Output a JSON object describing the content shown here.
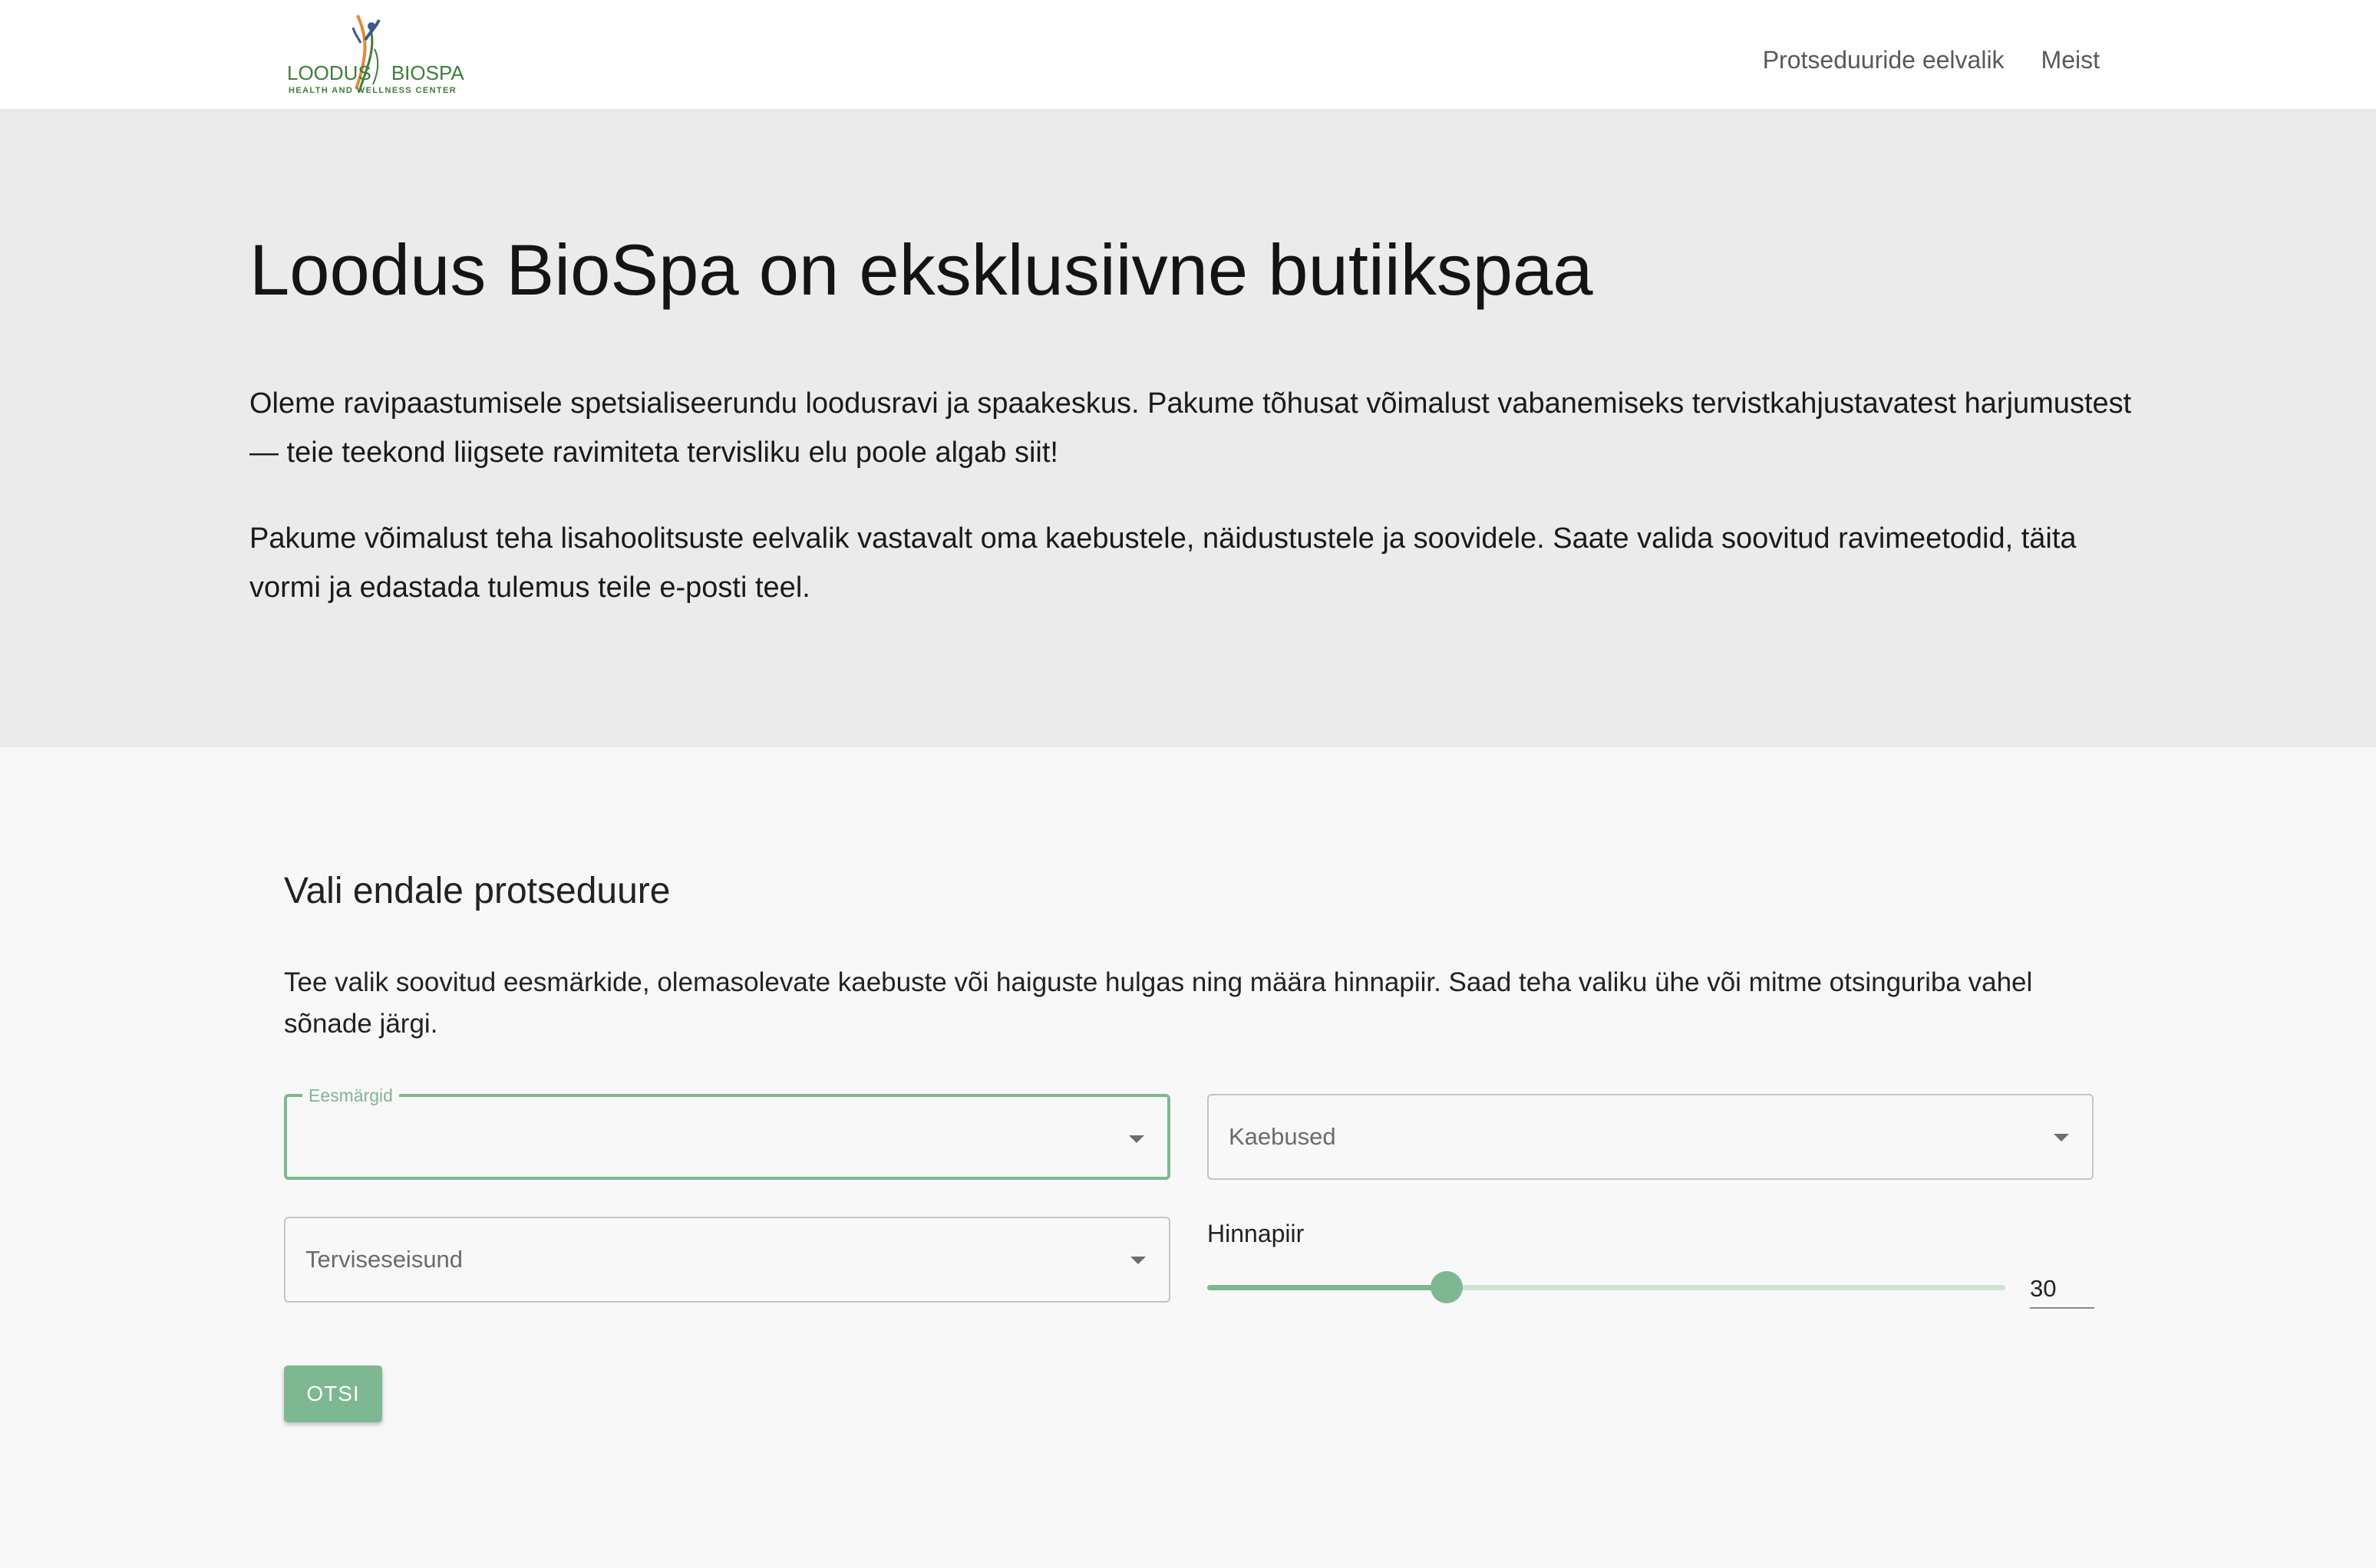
{
  "header": {
    "logo": {
      "brand_left": "LOODUS",
      "brand_right": "BIOSPA",
      "tagline": "HEALTH AND WELLNESS CENTER"
    },
    "nav": [
      {
        "label": "Protseduuride eelvalik"
      },
      {
        "label": "Meist"
      }
    ]
  },
  "hero": {
    "title": "Loodus BioSpa on eksklusiivne butiikspaa",
    "paragraph_1": "Oleme ravipaastumisele spetsialiseerundu loodusravi ja spaakeskus. Pakume tõhusat võimalust vabanemiseks tervistkahjustavatest harjumustest — teie teekond liigsete ravimiteta tervisliku elu poole algab siit!",
    "paragraph_2": "Pakume võimalust teha lisahoolitsuste eelvalik vastavalt oma kaebustele, näidustustele ja soovidele. Saate valida soovitud ravimeetodid, täita vormi ja edastada tulemus teile e-posti teel."
  },
  "selection": {
    "title": "Vali endale protseduure",
    "intro": "Tee valik soovitud eesmärkide, olemasolevate kaebuste või haiguste hulgas ning määra hinnapiir. Saad teha valiku ühe või mitme otsinguriba vahel sõnade järgi.",
    "goals_label": "Eesmärgid",
    "complaints_placeholder": "Kaebused",
    "health_placeholder": "Terviseseisund",
    "price_label": "Hinnapiir",
    "price_value": "30",
    "price_fraction": 0.3,
    "search_label": "OTSI"
  },
  "colors": {
    "accent": "#7eb893",
    "hero_bg": "#ebebeb",
    "page_bg": "#f8f8f8",
    "brand_green": "#3f7d3a",
    "logo_orange": "#e08a3a",
    "logo_blue": "#3a5a8c"
  }
}
